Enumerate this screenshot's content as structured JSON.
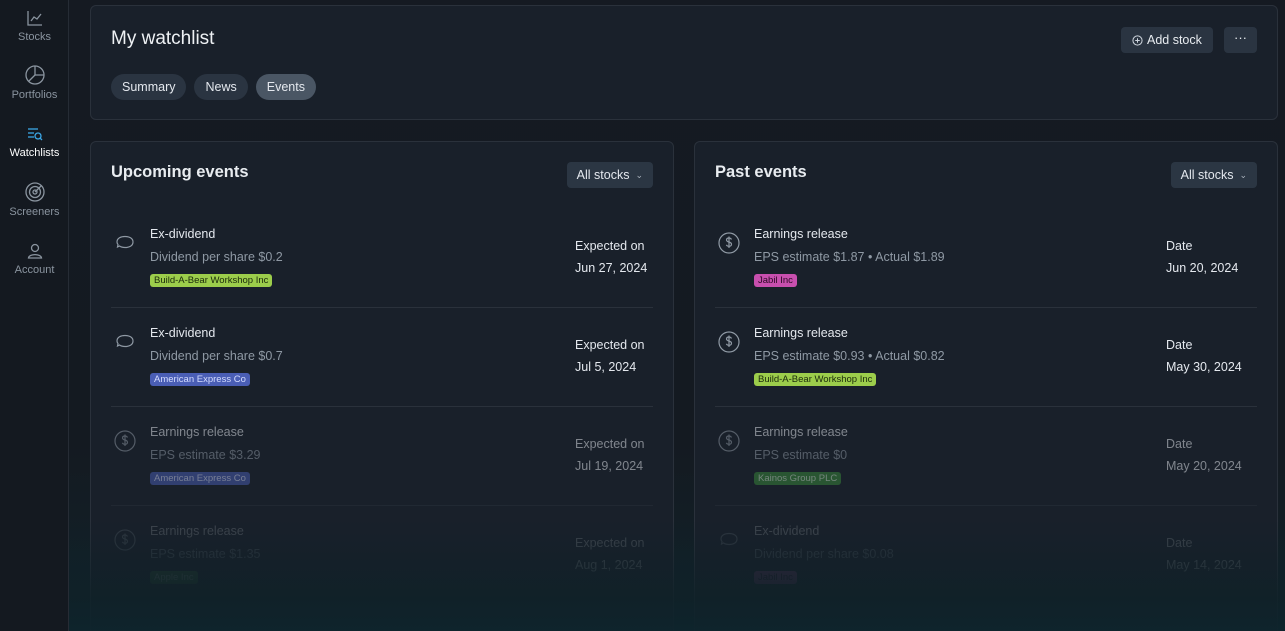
{
  "sidebar": {
    "items": [
      {
        "label": "Stocks",
        "icon": "chart-line-icon"
      },
      {
        "label": "Portfolios",
        "icon": "pie-chart-icon"
      },
      {
        "label": "Watchlists",
        "icon": "list-search-icon"
      },
      {
        "label": "Screeners",
        "icon": "radar-icon"
      },
      {
        "label": "Account",
        "icon": "user-icon"
      }
    ],
    "active": "Watchlists",
    "active_color": "#3ba7e6"
  },
  "header": {
    "title": "My watchlist",
    "tabs": [
      {
        "label": "Summary"
      },
      {
        "label": "News"
      },
      {
        "label": "Events"
      }
    ],
    "active_tab": "Events",
    "add_stock_label": "Add stock",
    "more_label": "···"
  },
  "upcoming": {
    "title": "Upcoming events",
    "filter": "All stocks",
    "events": [
      {
        "title": "Ex-dividend",
        "detail": "Dividend per share $0.2",
        "badge": "Build-A-Bear Workshop Inc",
        "when_label": "Expected on",
        "when_date": "Jun 27, 2024",
        "icon": "piggy-bank-icon"
      },
      {
        "title": "Ex-dividend",
        "detail": "Dividend per share $0.7",
        "badge": "American Express Co",
        "when_label": "Expected on",
        "when_date": "Jul 5, 2024",
        "icon": "piggy-bank-icon"
      },
      {
        "title": "Earnings release",
        "detail": "EPS estimate $3.29",
        "badge": "American Express Co",
        "when_label": "Expected on",
        "when_date": "Jul 19, 2024",
        "icon": "dollar-circle-icon"
      },
      {
        "title": "Earnings release",
        "detail": "EPS estimate $1.35",
        "badge": "Apple Inc",
        "when_label": "Expected on",
        "when_date": "Aug 1, 2024",
        "icon": "dollar-circle-icon"
      }
    ]
  },
  "past": {
    "title": "Past events",
    "filter": "All stocks",
    "events": [
      {
        "title": "Earnings release",
        "detail": "EPS estimate $1.87 • Actual $1.89",
        "badge": "Jabil Inc",
        "when_label": "Date",
        "when_date": "Jun 20, 2024",
        "icon": "dollar-circle-icon"
      },
      {
        "title": "Earnings release",
        "detail": "EPS estimate $0.93 • Actual $0.82",
        "badge": "Build-A-Bear Workshop Inc",
        "when_label": "Date",
        "when_date": "May 30, 2024",
        "icon": "dollar-circle-icon"
      },
      {
        "title": "Earnings release",
        "detail": "EPS estimate $0",
        "badge": "Kainos Group PLC",
        "when_label": "Date",
        "when_date": "May 20, 2024",
        "icon": "dollar-circle-icon"
      },
      {
        "title": "Ex-dividend",
        "detail": "Dividend per share $0.08",
        "badge": "Jabil Inc",
        "when_label": "Date",
        "when_date": "May 14, 2024",
        "icon": "piggy-bank-icon"
      }
    ]
  }
}
